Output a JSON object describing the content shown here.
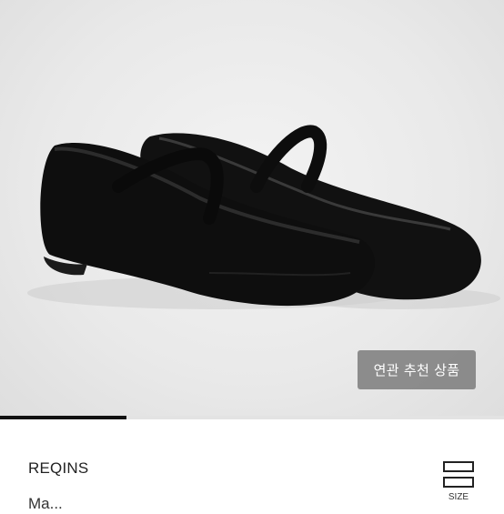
{
  "product_image": {
    "alt": "black ballet flats with elastic strap"
  },
  "related_button": {
    "label": "연관 추천 상품"
  },
  "carousel": {
    "progress": 0.25
  },
  "product": {
    "brand": "REQINS",
    "title_partial": "Ma..."
  },
  "size_guide": {
    "label": "SIZE",
    "icon": "size-guide-icon"
  }
}
